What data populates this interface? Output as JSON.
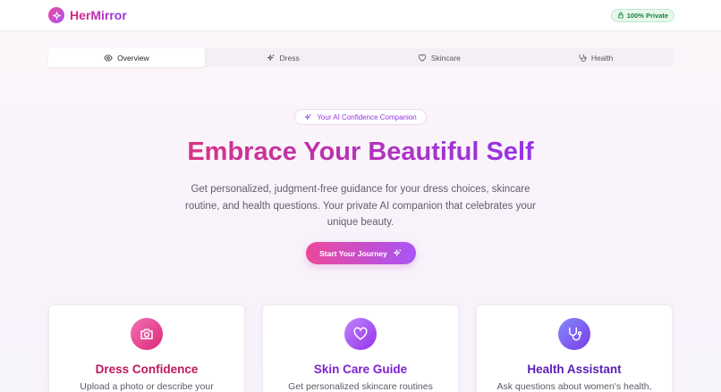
{
  "header": {
    "brand": "HerMirror",
    "privacy_badge": "100% Private"
  },
  "tabs": [
    {
      "label": "Overview",
      "icon": "eye-icon",
      "active": true
    },
    {
      "label": "Dress",
      "icon": "sparkles-icon",
      "active": false
    },
    {
      "label": "Skincare",
      "icon": "heart-icon",
      "active": false
    },
    {
      "label": "Health",
      "icon": "stethoscope-icon",
      "active": false
    }
  ],
  "hero": {
    "pill": "Your AI Confidence Companion",
    "title": "Embrace Your Beautiful Self",
    "subtitle": "Get personalized, judgment-free guidance for your dress choices, skincare routine, and health questions. Your private AI companion that celebrates your unique beauty.",
    "cta": "Start Your Journey"
  },
  "cards": [
    {
      "title": "Dress Confidence",
      "desc": "Upload a photo or describe your",
      "icon": "camera-icon",
      "title_color": "#be185d",
      "icon_gradient": [
        "#f472b6",
        "#db2777"
      ]
    },
    {
      "title": "Skin Care Guide",
      "desc": "Get personalized skincare routines",
      "icon": "heart-icon",
      "title_color": "#7e22ce",
      "icon_gradient": [
        "#c084fc",
        "#9333ea"
      ]
    },
    {
      "title": "Health Assistant",
      "desc": "Ask questions about women's health,",
      "icon": "stethoscope-icon",
      "title_color": "#5b21b6",
      "icon_gradient": [
        "#818cf8",
        "#7c3aed"
      ]
    }
  ],
  "colors": {
    "accent_pink": "#ec4899",
    "accent_purple": "#a855f7",
    "privacy_green": "#15803d"
  }
}
